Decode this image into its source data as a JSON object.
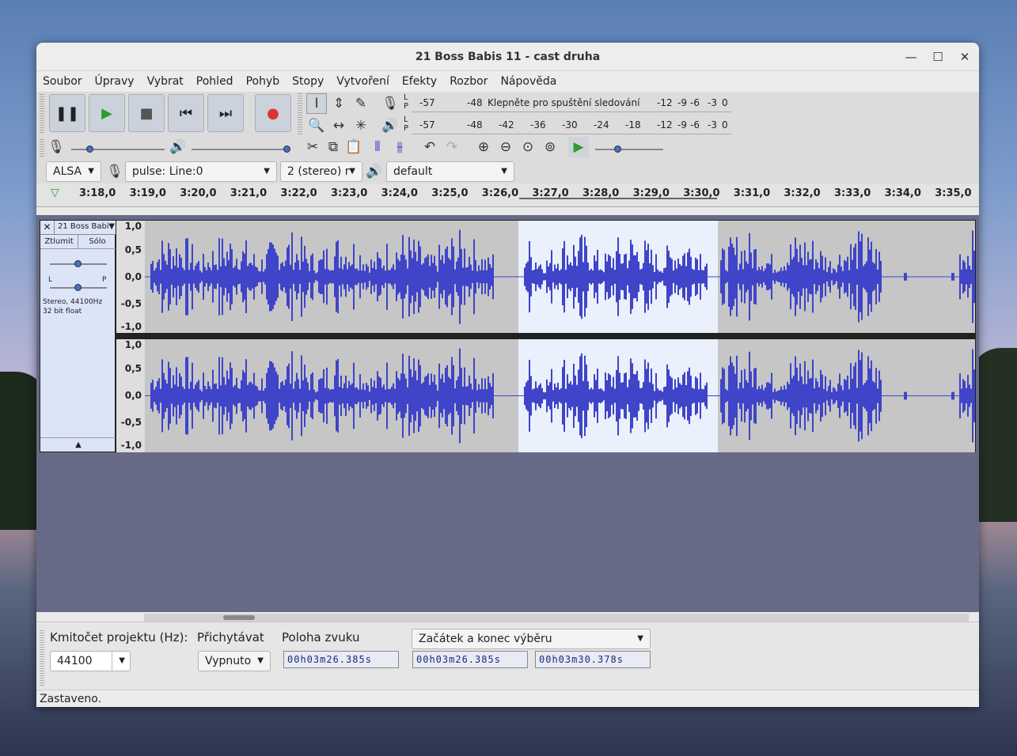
{
  "window": {
    "title": "21 Boss Babis 11 - cast druha"
  },
  "menu": [
    "Soubor",
    "Úpravy",
    "Vybrat",
    "Pohled",
    "Pohyb",
    "Stopy",
    "Vytvoření",
    "Efekty",
    "Rozbor",
    "Nápověda"
  ],
  "meters": {
    "record_scale": [
      "-57",
      "-48"
    ],
    "record_hint": "Klepněte pro spuštění sledování",
    "record_scale_right": [
      "-12",
      "-9",
      "-6",
      "-3",
      "0"
    ],
    "play_scale": [
      "-57",
      "-48",
      "-42",
      "-36",
      "-30",
      "-24",
      "-18",
      "-12",
      "-9",
      "-6",
      "-3",
      "0"
    ],
    "lp": [
      "L",
      "P"
    ]
  },
  "device": {
    "host": "ALSA",
    "input": "pulse: Line:0",
    "channels": "2 (stereo) r",
    "output": "default"
  },
  "ruler": [
    "3:18,0",
    "3:19,0",
    "3:20,0",
    "3:21,0",
    "3:22,0",
    "3:23,0",
    "3:24,0",
    "3:25,0",
    "3:26,0",
    "3:27,0",
    "3:28,0",
    "3:29,0",
    "3:30,0",
    "3:31,0",
    "3:32,0",
    "3:33,0",
    "3:34,0",
    "3:35,0"
  ],
  "track": {
    "name": "21 Boss Babi",
    "mute": "Ztlumit",
    "solo": "Sólo",
    "pan_left": "L",
    "pan_right": "P",
    "info_line1": "Stereo, 44100Hz",
    "info_line2": "32 bit float",
    "scale": [
      "1,0",
      "0,5",
      "0,0",
      "-0,5",
      "-1,0"
    ]
  },
  "bottom": {
    "rate_label": "Kmitočet projektu (Hz):",
    "rate_value": "44100",
    "snap_label": "Přichytávat",
    "snap_value": "Vypnuto",
    "pos_label": "Poloha zvuku",
    "sel_mode": "Začátek a konec výběru",
    "pos_time": "00h03m26.385s",
    "sel_start": "00h03m26.385s",
    "sel_end": "00h03m30.378s"
  },
  "status": "Zastaveno.",
  "colors": {
    "wave": "#3f44c8",
    "selection": "#eaf0fc",
    "track_bg": "#c6c6c6"
  }
}
